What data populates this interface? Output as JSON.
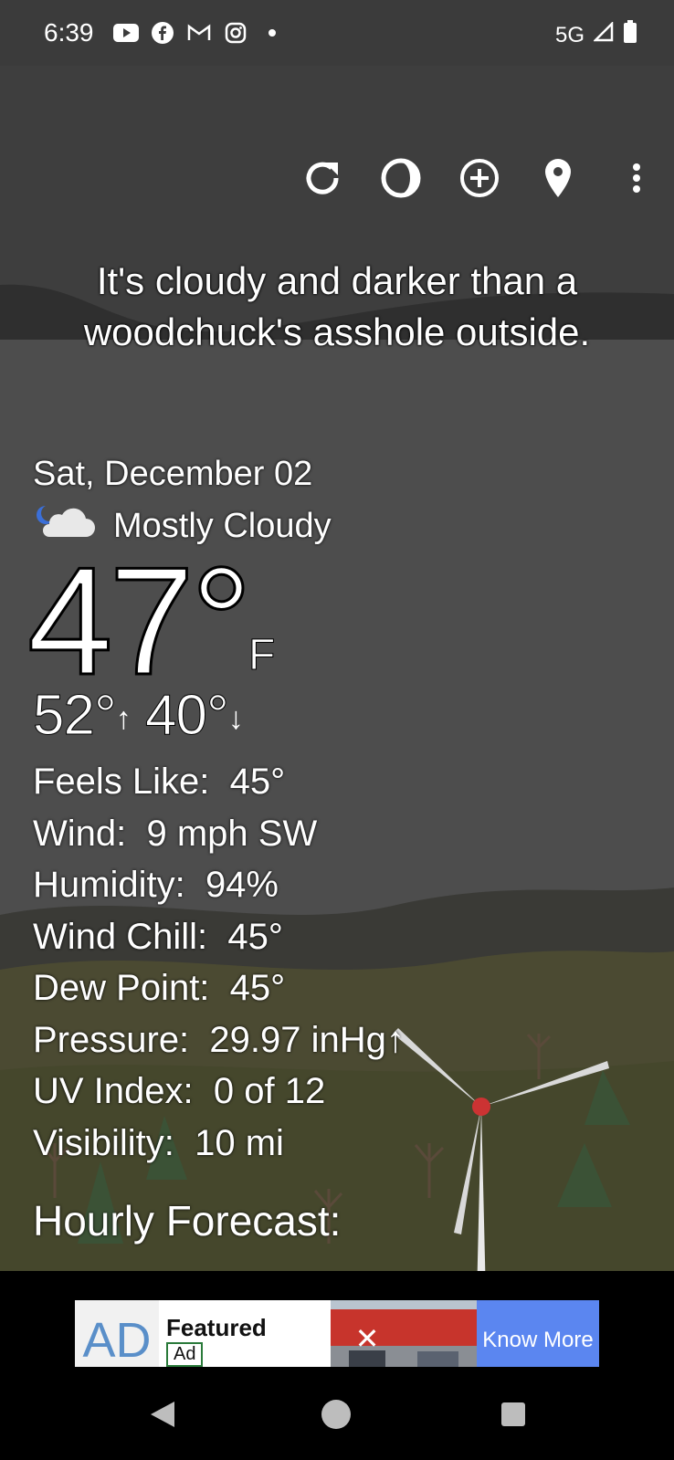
{
  "status_bar": {
    "time": "6:39",
    "network": "5G",
    "app_icons": [
      "youtube-icon",
      "facebook-icon",
      "gmail-icon",
      "instagram-icon",
      "dot-icon"
    ]
  },
  "toolbar": {
    "buttons": [
      "refresh-icon",
      "theme-icon",
      "add-location-icon",
      "location-pin-icon",
      "more-vert-icon"
    ]
  },
  "headline": {
    "line1": "It's cloudy and darker than a",
    "line2": "woodchuck's asshole outside."
  },
  "weather": {
    "date": "Sat, December 02",
    "condition": "Mostly Cloudy",
    "condition_icon": "cloudy-night-icon",
    "temperature": "47°",
    "unit": "F",
    "high": "52°",
    "low": "40°",
    "details": [
      {
        "label": "Feels Like:",
        "value": "45°"
      },
      {
        "label": "Wind:",
        "value": "9 mph SW"
      },
      {
        "label": "Humidity:",
        "value": "94%"
      },
      {
        "label": "Wind Chill:",
        "value": "45°"
      },
      {
        "label": "Dew Point:",
        "value": "45°"
      },
      {
        "label": "Pressure:",
        "value": "29.97 inHg↑"
      },
      {
        "label": "UV Index:",
        "value": "0 of 12"
      },
      {
        "label": "Visibility:",
        "value": "10 mi"
      }
    ]
  },
  "hourly_title": "Hourly Forecast:",
  "ad": {
    "logo": "AD",
    "title": "Featured",
    "badge": "Ad",
    "cta": "Know More"
  },
  "colors": {
    "ad_cta": "#5b86f0",
    "sky": "#3d3d3d"
  }
}
